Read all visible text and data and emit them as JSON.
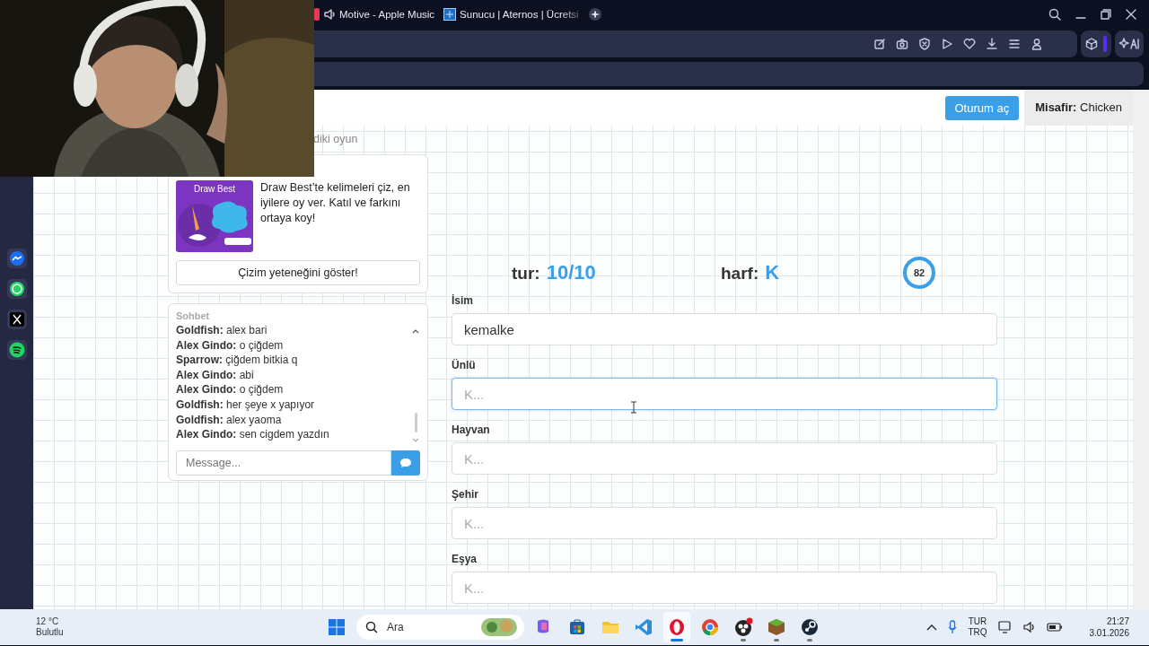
{
  "browser": {
    "tabs": [
      {
        "label": "Motive - Apple Music",
        "selected": false,
        "audio": true
      },
      {
        "label": "Sunucu | Aternos | Ücretsi",
        "selected": false,
        "audio": false
      }
    ]
  },
  "page": {
    "header": {
      "login_button": "Oturum aç",
      "guest": "**Misafir:** Chicken"
    },
    "section_heading": "diki oyun",
    "promo": {
      "image_title": "Draw Best",
      "description": "Draw Best’te kelimeleri çiz, en iyilere oy ver. Katıl ve farkını ortaya koy!",
      "button": "Çizim yeteneğini göster!"
    },
    "chat": {
      "title": "Sohbet",
      "messages": [
        "**Goldfish:** alex bari",
        "**Alex Gindo:** o çiğdem",
        "**Sparrow:** çiğdem bitkia q",
        "**Alex Gindo:** abi",
        "**Alex Gindo:** o çiğdem",
        "**Goldfish:** her şeye x yapıyor",
        "**Goldfish:** alex yaoma",
        "**Alex Gindo:** sen cigdem yazdın"
      ],
      "input": {
        "placeholder": "Message..."
      }
    },
    "game": {
      "round_label": "tur:",
      "round": "10/10",
      "letter_label": "harf:",
      "letter": "K",
      "timer": "82",
      "fields": [
        {
          "label": "İsim",
          "value": "kemalke",
          "focused": false
        },
        {
          "label": "Ünlü",
          "placeholder": "K...",
          "focused": true
        },
        {
          "label": "Hayvan",
          "placeholder": "K...",
          "focused": false
        },
        {
          "label": "Şehir",
          "placeholder": "K...",
          "focused": false
        },
        {
          "label": "Eşya",
          "placeholder": "K...",
          "focused": false
        }
      ]
    }
  },
  "taskbar": {
    "weather": {
      "temperature": "12 °C",
      "condition": "Bulutlu"
    },
    "search": {
      "placeholder": "Ara"
    },
    "apps": [
      {
        "running": false,
        "selected": false
      },
      {
        "running": false,
        "selected": false
      },
      {
        "running": false,
        "selected": false
      },
      {
        "running": false,
        "selected": false
      },
      {
        "running": true,
        "selected": true
      },
      {
        "running": false,
        "selected": false
      },
      {
        "running": true,
        "selected": false
      },
      {
        "running": true,
        "selected": false
      },
      {
        "running": true,
        "selected": false
      }
    ],
    "language": {
      "code": "TUR",
      "layout": "TRQ"
    },
    "time": "21:27",
    "date": "3.01.2026"
  }
}
